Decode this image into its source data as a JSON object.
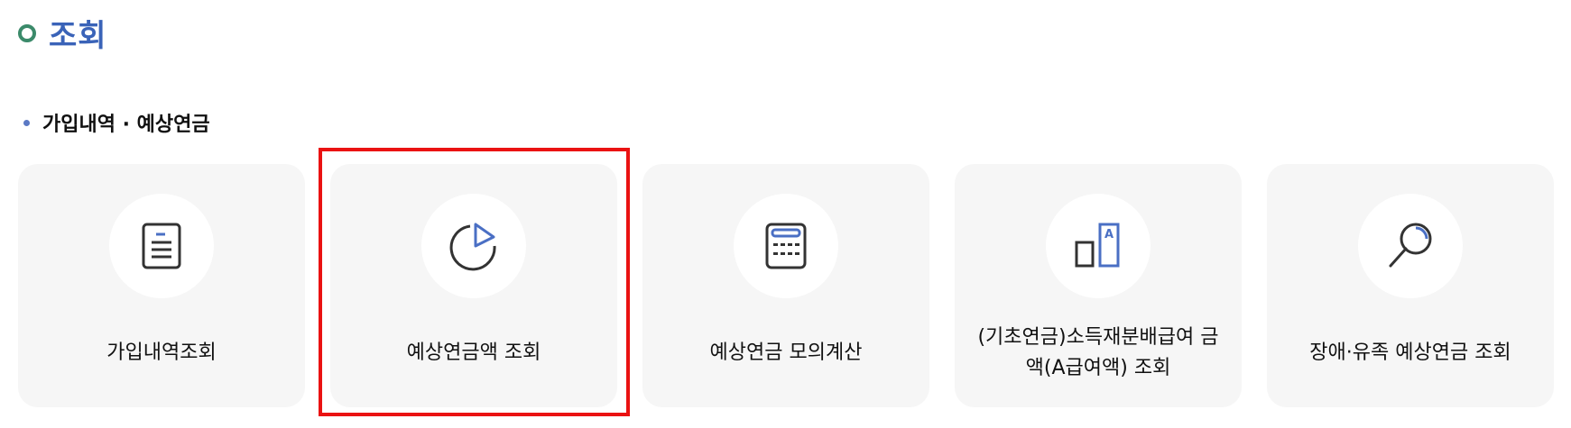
{
  "page": {
    "title": "조회"
  },
  "section": {
    "title": "가입내역 · 예상연금"
  },
  "cards": [
    {
      "label": "가입내역조회",
      "icon": "document-icon"
    },
    {
      "label": "예상연금액 조회",
      "icon": "pie-chart-icon"
    },
    {
      "label": "예상연금 모의계산",
      "icon": "calculator-icon"
    },
    {
      "label": "(기초연금)소득재분배급여 금액(A급여액) 조회",
      "icon": "a-bar-icon"
    },
    {
      "label": "장애·유족 예상연금 조회",
      "icon": "search-icon"
    }
  ],
  "colors": {
    "title": "#3a63b8",
    "title_bullet": "#3b8a6a",
    "section_dot": "#5b79c4",
    "card_bg": "#f6f6f6",
    "highlight": "#ea1212",
    "icon_accent": "#4a6fc4",
    "icon_dark": "#333333"
  }
}
